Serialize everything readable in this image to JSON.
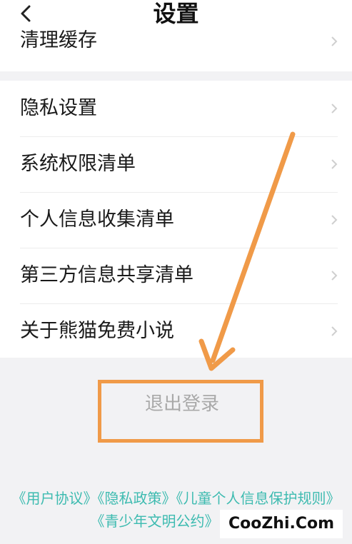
{
  "header": {
    "title": "设置"
  },
  "settings": {
    "cache_item": "清理缓存",
    "items": [
      {
        "label": "隐私设置"
      },
      {
        "label": "系统权限清单"
      },
      {
        "label": "个人信息收集清单"
      },
      {
        "label": "第三方信息共享清单"
      },
      {
        "label": "关于熊猫免费小说"
      }
    ]
  },
  "logout": {
    "label": "退出登录"
  },
  "footer": {
    "links": [
      "《用户协议》",
      "《隐私政策》",
      "《儿童个人信息保护规则》",
      "《青少年文明公约》"
    ]
  },
  "annotation": {
    "color": "#f09a48"
  },
  "watermark": {
    "text": "CooZhi.Com"
  },
  "colors": {
    "link": "#3dbbb0",
    "background": "#f2f2f4"
  }
}
